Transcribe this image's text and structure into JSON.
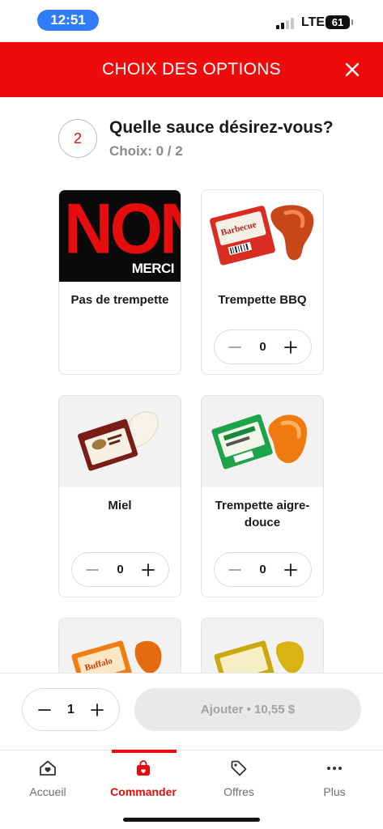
{
  "status_bar": {
    "time": "12:51",
    "network": "LTE",
    "battery": "61"
  },
  "header": {
    "title": "CHOIX DES OPTIONS",
    "close_icon": "close-icon"
  },
  "question": {
    "step": "2",
    "title": "Quelle sauce désirez-vous?",
    "choices": "Choix: 0 / 2"
  },
  "options": [
    {
      "label": "Pas de trempette",
      "image_text_big": "NON",
      "image_text_small": "MERCI"
    },
    {
      "label": "Trempette BBQ",
      "quantity": "0",
      "package_text": "Barbecue"
    },
    {
      "label": "Miel",
      "quantity": "0"
    },
    {
      "label": "Trempette aigre-douce",
      "quantity": "0"
    },
    {
      "label": "",
      "package_text": "Buffalo"
    },
    {
      "label": ""
    }
  ],
  "add_bar": {
    "quantity": "1",
    "add_label": "Ajouter • 10,55 $"
  },
  "nav": {
    "items": [
      {
        "label": "Accueil",
        "icon": "home-heart-icon"
      },
      {
        "label": "Commander",
        "icon": "shopping-bag-icon"
      },
      {
        "label": "Offres",
        "icon": "tag-icon"
      },
      {
        "label": "Plus",
        "icon": "more-dots-icon"
      }
    ],
    "active": "Commander"
  },
  "colors": {
    "brand_red": "#ee0b0b",
    "time_pill": "#2f7cf6",
    "disabled_bg": "#e9e9e9"
  }
}
